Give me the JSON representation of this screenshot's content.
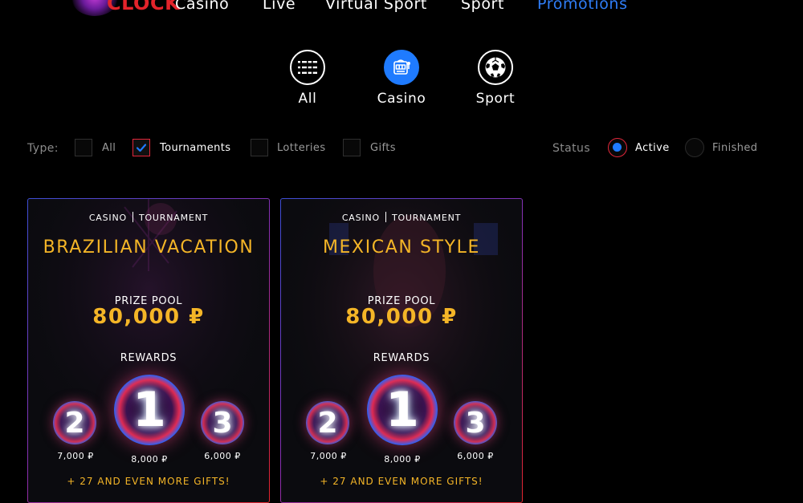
{
  "header": {
    "logo_text": "CLOCK",
    "nav": [
      {
        "label": "Casino",
        "active": false
      },
      {
        "label": "Live",
        "active": false
      },
      {
        "label": "Virtual Sport",
        "active": false
      },
      {
        "label": "Sport",
        "active": false
      },
      {
        "label": "Promotions",
        "active": true
      }
    ]
  },
  "categories": [
    {
      "label": "All",
      "icon": "grid-list-icon",
      "active": false
    },
    {
      "label": "Casino",
      "icon": "slot-machine-icon",
      "active": true
    },
    {
      "label": "Sport",
      "icon": "soccer-ball-icon",
      "active": false
    }
  ],
  "filters": {
    "type_label": "Type:",
    "types": [
      {
        "label": "All",
        "checked": false
      },
      {
        "label": "Tournaments",
        "checked": true
      },
      {
        "label": "Lotteries",
        "checked": false
      },
      {
        "label": "Gifts",
        "checked": false
      }
    ],
    "status_label": "Status",
    "statuses": [
      {
        "label": "Active",
        "selected": true
      },
      {
        "label": "Finished",
        "selected": false
      }
    ]
  },
  "promotions": [
    {
      "category": "CASINO",
      "kind": "TOURNAMENT",
      "title": "BRAZILIAN VACATION",
      "prize_pool_label": "PRIZE POOL",
      "prize_pool": "80,000 ₽",
      "rewards_label": "REWARDS",
      "rewards": [
        {
          "place": "2",
          "amount": "7,000 ₽"
        },
        {
          "place": "1",
          "amount": "8,000 ₽"
        },
        {
          "place": "3",
          "amount": "6,000 ₽"
        }
      ],
      "more_text": "+ 27 AND EVEN MORE GIFTS!"
    },
    {
      "category": "CASINO",
      "kind": "TOURNAMENT",
      "title": "MEXICAN STYLE",
      "prize_pool_label": "PRIZE POOL",
      "prize_pool": "80,000 ₽",
      "rewards_label": "REWARDS",
      "rewards": [
        {
          "place": "2",
          "amount": "7,000 ₽"
        },
        {
          "place": "1",
          "amount": "8,000 ₽"
        },
        {
          "place": "3",
          "amount": "6,000 ₽"
        }
      ],
      "more_text": "+ 27 AND EVEN MORE GIFTS!"
    }
  ],
  "colors": {
    "accent_blue": "#1f7bff",
    "accent_red": "#e2263a",
    "gold": "#f4b527"
  }
}
